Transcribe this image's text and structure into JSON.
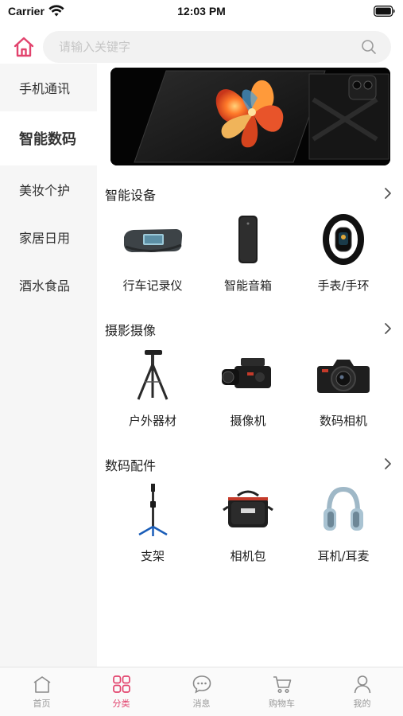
{
  "status_bar": {
    "carrier": "Carrier",
    "time": "12:03 PM"
  },
  "search": {
    "placeholder": "请输入关键字",
    "value": ""
  },
  "sidebar": {
    "items": [
      {
        "label": "手机通讯",
        "active": false
      },
      {
        "label": "智能数码",
        "active": true
      },
      {
        "label": "美妆个护",
        "active": false
      },
      {
        "label": "家居日用",
        "active": false
      },
      {
        "label": "酒水食品",
        "active": false
      }
    ]
  },
  "sections": [
    {
      "title": "智能设备",
      "items": [
        {
          "label": "行车记录仪",
          "icon": "dashcam-icon"
        },
        {
          "label": "智能音箱",
          "icon": "smart-speaker-icon"
        },
        {
          "label": "手表/手环",
          "icon": "fitness-band-icon"
        }
      ]
    },
    {
      "title": "摄影摄像",
      "items": [
        {
          "label": "户外器材",
          "icon": "tripod-icon"
        },
        {
          "label": "摄像机",
          "icon": "camcorder-icon"
        },
        {
          "label": "数码相机",
          "icon": "camera-icon"
        }
      ]
    },
    {
      "title": "数码配件",
      "items": [
        {
          "label": "支架",
          "icon": "monopod-icon"
        },
        {
          "label": "相机包",
          "icon": "camera-bag-icon"
        },
        {
          "label": "耳机/耳麦",
          "icon": "headphones-icon"
        }
      ]
    }
  ],
  "tab_bar": {
    "tabs": [
      {
        "label": "首页",
        "icon": "home-icon",
        "active": false
      },
      {
        "label": "分类",
        "icon": "category-icon",
        "active": true
      },
      {
        "label": "消息",
        "icon": "message-icon",
        "active": false
      },
      {
        "label": "购物车",
        "icon": "cart-icon",
        "active": false
      },
      {
        "label": "我的",
        "icon": "user-icon",
        "active": false
      }
    ]
  },
  "colors": {
    "accent": "#e2436d",
    "sidebar_bg": "#f6f6f6",
    "search_bg": "#f2f2f2",
    "inactive": "#999999"
  }
}
